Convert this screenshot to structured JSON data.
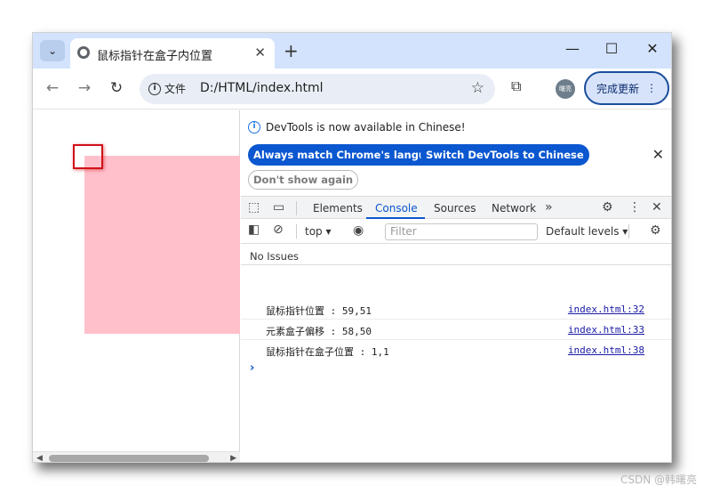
{
  "browser": {
    "tab_title": "鼠标指针在盒子内位置",
    "new_tab_symbol": "+",
    "url_chip_label": "文件",
    "url": "D:/HTML/index.html",
    "profile_text": "曙亮",
    "update_button_label": "完成更新"
  },
  "page": {
    "box_color": "#ffc0cb",
    "marker_color": "#d0101a"
  },
  "devtools": {
    "banner_text": "DevTools is now available in Chinese!",
    "btn_match_language": "Always match Chrome's language",
    "btn_switch_chinese": "Switch DevTools to Chinese",
    "btn_dont_show": "Don't show again",
    "tabs": [
      "Elements",
      "Console",
      "Sources",
      "Network"
    ],
    "active_tab": "Console",
    "context": "top",
    "filter_placeholder": "Filter",
    "levels_label": "Default levels",
    "issues_label": "No Issues",
    "logs": [
      {
        "message": "鼠标指针位置 : 59,51",
        "source": "index.html:32"
      },
      {
        "message": "元素盒子偏移 : 58,50",
        "source": "index.html:33"
      },
      {
        "message": "鼠标指针在盒子位置 : 1,1",
        "source": "index.html:38"
      }
    ],
    "accent_color": "#0b57d0"
  },
  "watermark": "CSDN @韩曙亮"
}
